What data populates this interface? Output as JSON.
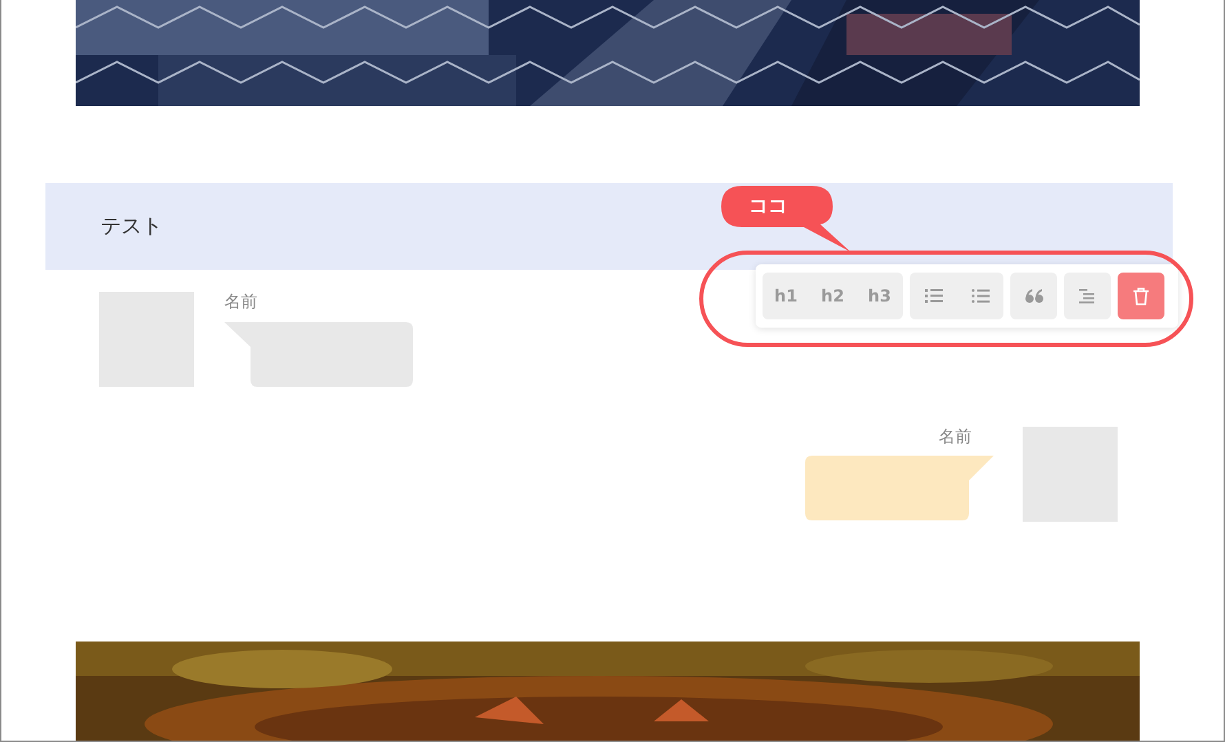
{
  "heading": {
    "text": "テスト"
  },
  "toolbar": {
    "groups": [
      {
        "buttons": [
          {
            "kind": "text",
            "label": "h1"
          },
          {
            "kind": "text",
            "label": "h2"
          },
          {
            "kind": "text",
            "label": "h3"
          }
        ]
      },
      {
        "buttons": [
          {
            "kind": "ordered-list"
          },
          {
            "kind": "bullet-list"
          }
        ]
      },
      {
        "buttons": [
          {
            "kind": "quote"
          }
        ]
      },
      {
        "buttons": [
          {
            "kind": "indent"
          }
        ]
      },
      {
        "buttons": [
          {
            "kind": "delete"
          }
        ]
      }
    ]
  },
  "messages": [
    {
      "kind": "received",
      "name": "名前"
    },
    {
      "kind": "sent",
      "name": "名前"
    }
  ],
  "annotation": {
    "callout": "ココ"
  }
}
